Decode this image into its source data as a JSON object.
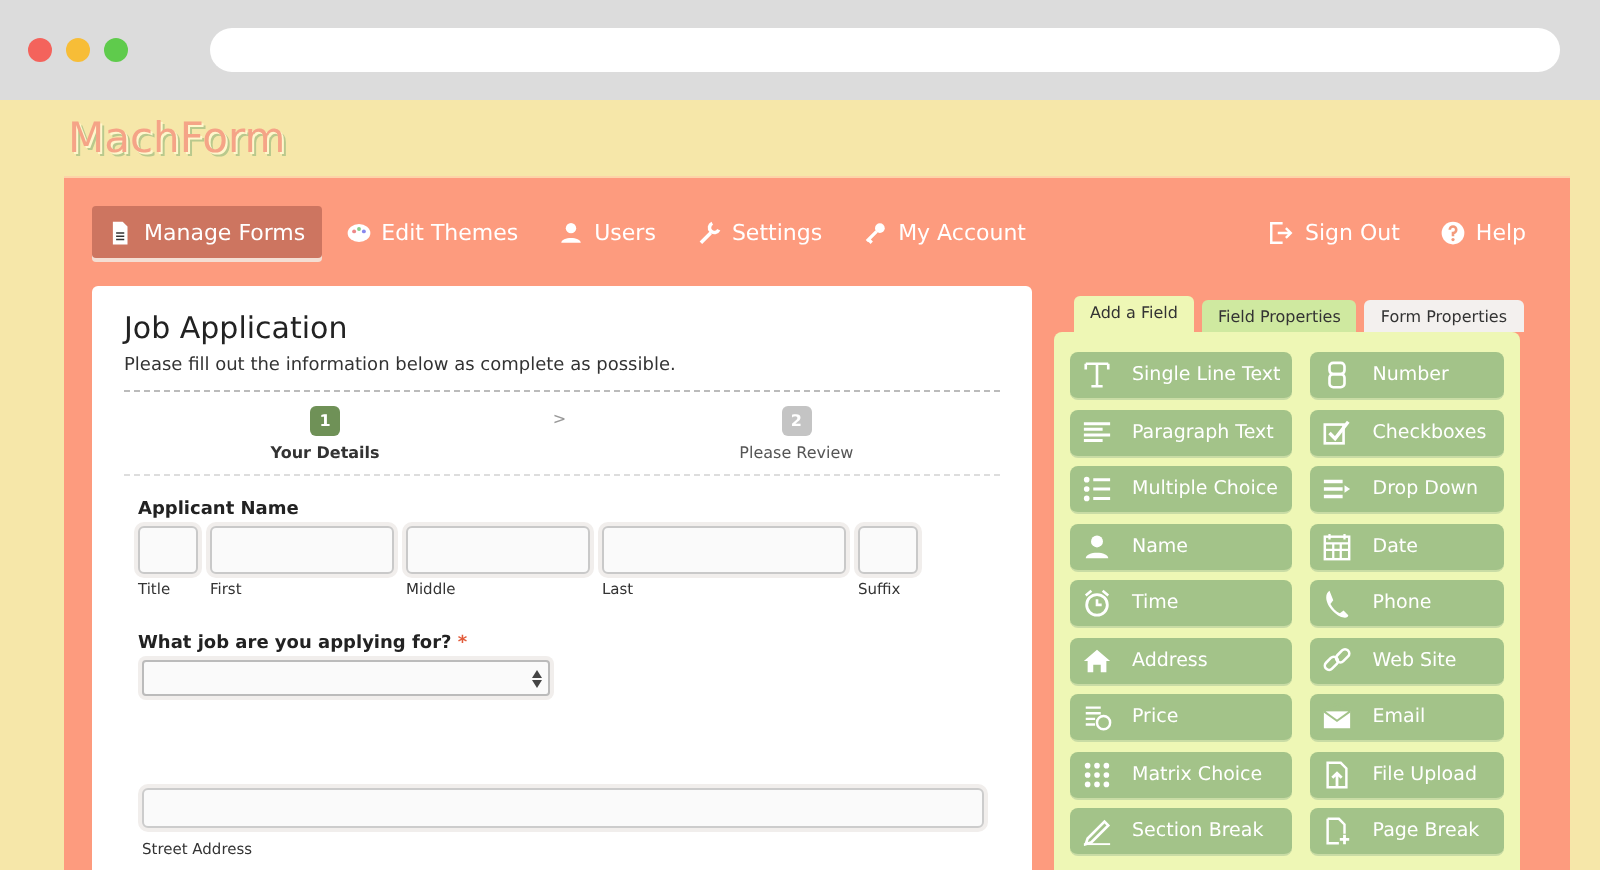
{
  "logo": "MachForm",
  "nav": [
    {
      "label": "Manage Forms",
      "kind": "document",
      "selected": true
    },
    {
      "label": "Edit Themes",
      "kind": "palette",
      "selected": false
    },
    {
      "label": "Users",
      "kind": "user",
      "selected": false
    },
    {
      "label": "Settings",
      "kind": "wrench",
      "selected": false
    },
    {
      "label": "My Account",
      "kind": "key",
      "selected": false
    }
  ],
  "nav_right": [
    {
      "label": "Sign Out",
      "kind": "signout"
    },
    {
      "label": "Help",
      "kind": "help"
    }
  ],
  "form": {
    "title": "Job Application",
    "description": "Please fill out the information below as complete as possible.",
    "steps": [
      {
        "number": "1",
        "label": "Your Details",
        "selected": true
      },
      {
        "number": "2",
        "label": "Please Review",
        "selected": false
      }
    ],
    "step_separator": ">",
    "name_field": {
      "label": "Applicant Name",
      "parts": [
        "Title",
        "First",
        "Middle",
        "Last",
        "Suffix"
      ]
    },
    "job_field": {
      "label": "What job are you applying for?",
      "required_mark": "*"
    },
    "address_field": {
      "sublabel": "Street Address"
    }
  },
  "tabs": [
    {
      "label": "Add a Field",
      "selected": true
    },
    {
      "label": "Field Properties",
      "selected": false
    },
    {
      "label": "Form Properties",
      "selected": false
    }
  ],
  "field_types": [
    {
      "label": "Single Line Text",
      "kind": "text"
    },
    {
      "label": "Number",
      "kind": "number"
    },
    {
      "label": "Paragraph Text",
      "kind": "paragraph"
    },
    {
      "label": "Checkboxes",
      "kind": "checkbox"
    },
    {
      "label": "Multiple Choice",
      "kind": "list"
    },
    {
      "label": "Drop Down",
      "kind": "dropdown"
    },
    {
      "label": "Name",
      "kind": "user"
    },
    {
      "label": "Date",
      "kind": "calendar"
    },
    {
      "label": "Time",
      "kind": "clock"
    },
    {
      "label": "Phone",
      "kind": "phone"
    },
    {
      "label": "Address",
      "kind": "house"
    },
    {
      "label": "Web Site",
      "kind": "link"
    },
    {
      "label": "Price",
      "kind": "price"
    },
    {
      "label": "Email",
      "kind": "envelope"
    },
    {
      "label": "Matrix Choice",
      "kind": "grid"
    },
    {
      "label": "File Upload",
      "kind": "upload"
    },
    {
      "label": "Section Break",
      "kind": "pencil"
    },
    {
      "label": "Page Break",
      "kind": "page"
    }
  ]
}
